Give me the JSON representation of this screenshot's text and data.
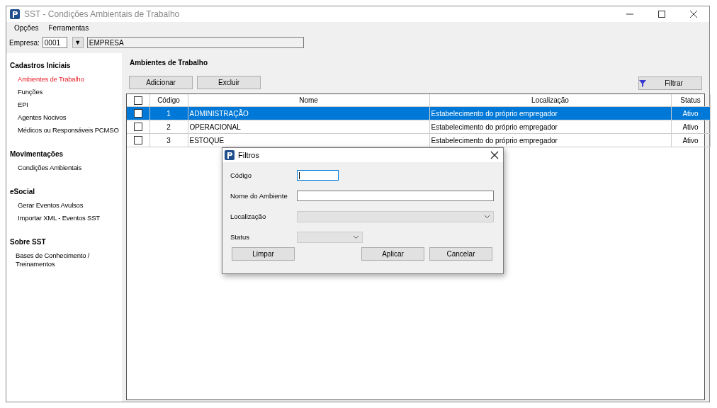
{
  "window": {
    "title": "SST - Condições Ambientais de Trabalho"
  },
  "menu": [
    {
      "label": "Opções"
    },
    {
      "label": "Ferramentas"
    }
  ],
  "empresa": {
    "label": "Empresa:",
    "code": "0001",
    "dropdown": "▼",
    "name": "EMPRESA"
  },
  "sidebar": [
    {
      "title": "Cadastros Iniciais",
      "items": [
        {
          "label": "Ambientes de Trabalho",
          "selected": true
        },
        {
          "label": "Funções",
          "selected": false
        },
        {
          "label": "EPI",
          "selected": false
        },
        {
          "label": "Agentes Nocivos",
          "selected": false
        },
        {
          "label": "Médicos ou Responsáveis PCMSO",
          "selected": false
        }
      ]
    },
    {
      "title": "Movimentações",
      "items": [
        {
          "label": "Condições Ambientais",
          "selected": false
        }
      ]
    },
    {
      "title": "eSocial",
      "items": [
        {
          "label": "Gerar Eventos Avulsos",
          "selected": false
        },
        {
          "label": "Importar XML - Eventos SST",
          "selected": false
        }
      ]
    },
    {
      "title": "Sobre SST",
      "items": [
        {
          "label": "Bases de Conhecimento / Treinamentos",
          "selected": false
        }
      ]
    }
  ],
  "content": {
    "heading": "Ambientes de Trabalho",
    "buttons": [
      {
        "label": "Adicionar"
      },
      {
        "label": "Excluir"
      }
    ],
    "filter_button": {
      "label": "Filtrar"
    }
  },
  "table": {
    "header_checked": false,
    "columns": [
      {
        "label": "Código"
      },
      {
        "label": "Nome"
      },
      {
        "label": "Localização"
      },
      {
        "label": "Status"
      }
    ],
    "rows": [
      {
        "checked": false,
        "selected": true,
        "cells": [
          "1",
          "ADMINISTRAÇÃO",
          "Estabelecimento do próprio empregador",
          "Ativo"
        ]
      },
      {
        "checked": false,
        "selected": false,
        "cells": [
          "2",
          "OPERACIONAL",
          "Estabelecimento do próprio empregador",
          "Ativo"
        ]
      },
      {
        "checked": false,
        "selected": false,
        "cells": [
          "3",
          "ESTOQUE",
          "Estabelecimento do próprio empregador",
          "Ativo"
        ]
      }
    ]
  },
  "dialog": {
    "title": "Filtros",
    "fields": [
      {
        "label": "Código",
        "kind": "text",
        "focused": true
      },
      {
        "label": "Nome do Ambiente",
        "kind": "text",
        "focused": false
      },
      {
        "label": "Localização",
        "kind": "combo",
        "disabled": true
      },
      {
        "label": "Status",
        "kind": "combo",
        "disabled": true
      }
    ],
    "buttons": [
      {
        "label": "Limpar"
      },
      {
        "label": "Aplicar"
      },
      {
        "label": "Cancelar"
      }
    ]
  }
}
